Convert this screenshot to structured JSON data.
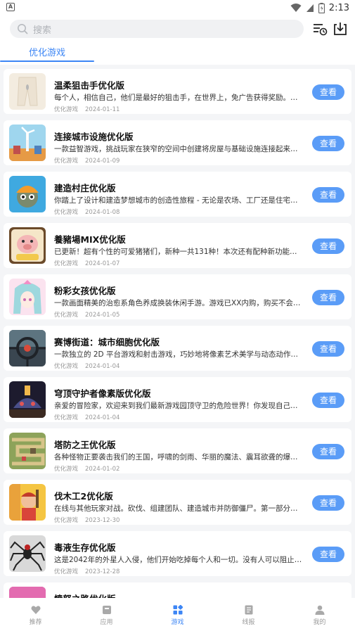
{
  "status_bar": {
    "time": "2:13",
    "left_badge": "A"
  },
  "search": {
    "placeholder": "搜索"
  },
  "tabs": [
    {
      "label": "优化游戏"
    }
  ],
  "list": {
    "action_label": "查看",
    "items": [
      {
        "title": "温柔狙击手优化版",
        "desc": "每个人，相信自己，他们是最好的狙击手，在世界上，免广告获得奖励。免广",
        "category": "优化游戏",
        "date": "2024-01-11",
        "icon": "pants-icon"
      },
      {
        "title": "连接城市设施优化版",
        "desc": "一款益智游戏，挑战玩家在狭窄的空间中创建将房屋与基础设施连接起来的网络",
        "category": "优化游戏",
        "date": "2024-01-09",
        "icon": "wind-turbine-icon"
      },
      {
        "title": "建造村庄优化版",
        "desc": "你踏上了设计和建造梦想城市的创造性旅程 - 无论是农场、工厂还是住宅区 - 你可以",
        "category": "优化游戏",
        "date": "2024-01-08",
        "icon": "builder-icon"
      },
      {
        "title": "養豬場MIX优化版",
        "desc": "已更新！超有个性的可爱猪猪们，新种一共131种！本次还有配种新功能，可以",
        "category": "优化游戏",
        "date": "2024-01-07",
        "icon": "pig-icon"
      },
      {
        "title": "粉彩女孩优化版",
        "desc": "一款画面精美的治愈系角色养成换装休闲手游。游戏已XX内购，购买不会弹出窗口",
        "category": "优化游戏",
        "date": "2024-01-05",
        "icon": "pastel-girl-icon"
      },
      {
        "title": "赛博街道：城市细胞优化版",
        "desc": "一款独立的 2D 平台游戏和射击游戏，巧妙地将像素艺术美学与动态动作相结合",
        "category": "优化游戏",
        "date": "2024-01-04",
        "icon": "crosshair-icon"
      },
      {
        "title": "穹顶守护者像素版优化版",
        "desc": "亲爱的冒险家，欢迎来到我们最新游戏园顶守卫的危险世界！你发现自己在一个",
        "category": "优化游戏",
        "date": "2024-01-04",
        "icon": "dome-icon"
      },
      {
        "title": "塔防之王优化版",
        "desc": "各种怪物正要袭击我们的王国，呼啸的剑雨、华丽的魔法、震耳欲聋的爆炸正在",
        "category": "优化游戏",
        "date": "2024-01-02",
        "icon": "tower-defense-icon"
      },
      {
        "title": "伐木工2优化版",
        "desc": "在线与其他玩家对战。砍伐、组建团队、建造城市并防御僵尸。第一部分有 50 多",
        "category": "优化游戏",
        "date": "2023-12-30",
        "icon": "lumberjack-icon"
      },
      {
        "title": "毒液生存优化版",
        "desc": "这是2042年的外星人入侵，他们开始吃掉每个人和一切。没有人可以阻止看起来",
        "category": "优化游戏",
        "date": "2023-12-28",
        "icon": "spider-icon"
      },
      {
        "title": "愤怒之路优化版",
        "desc": "",
        "category": "",
        "date": "",
        "icon": "road-icon"
      }
    ]
  },
  "bottom_nav": [
    {
      "label": "推荐",
      "icon": "heart-icon",
      "active": false
    },
    {
      "label": "应用",
      "icon": "app-icon",
      "active": false
    },
    {
      "label": "游戏",
      "icon": "game-grid-icon",
      "active": true
    },
    {
      "label": "线报",
      "icon": "document-icon",
      "active": false
    },
    {
      "label": "我的",
      "icon": "user-icon",
      "active": false
    }
  ],
  "colors": {
    "accent": "#3d86f5",
    "button": "#5a9cf7",
    "background": "#f4f5f7"
  }
}
